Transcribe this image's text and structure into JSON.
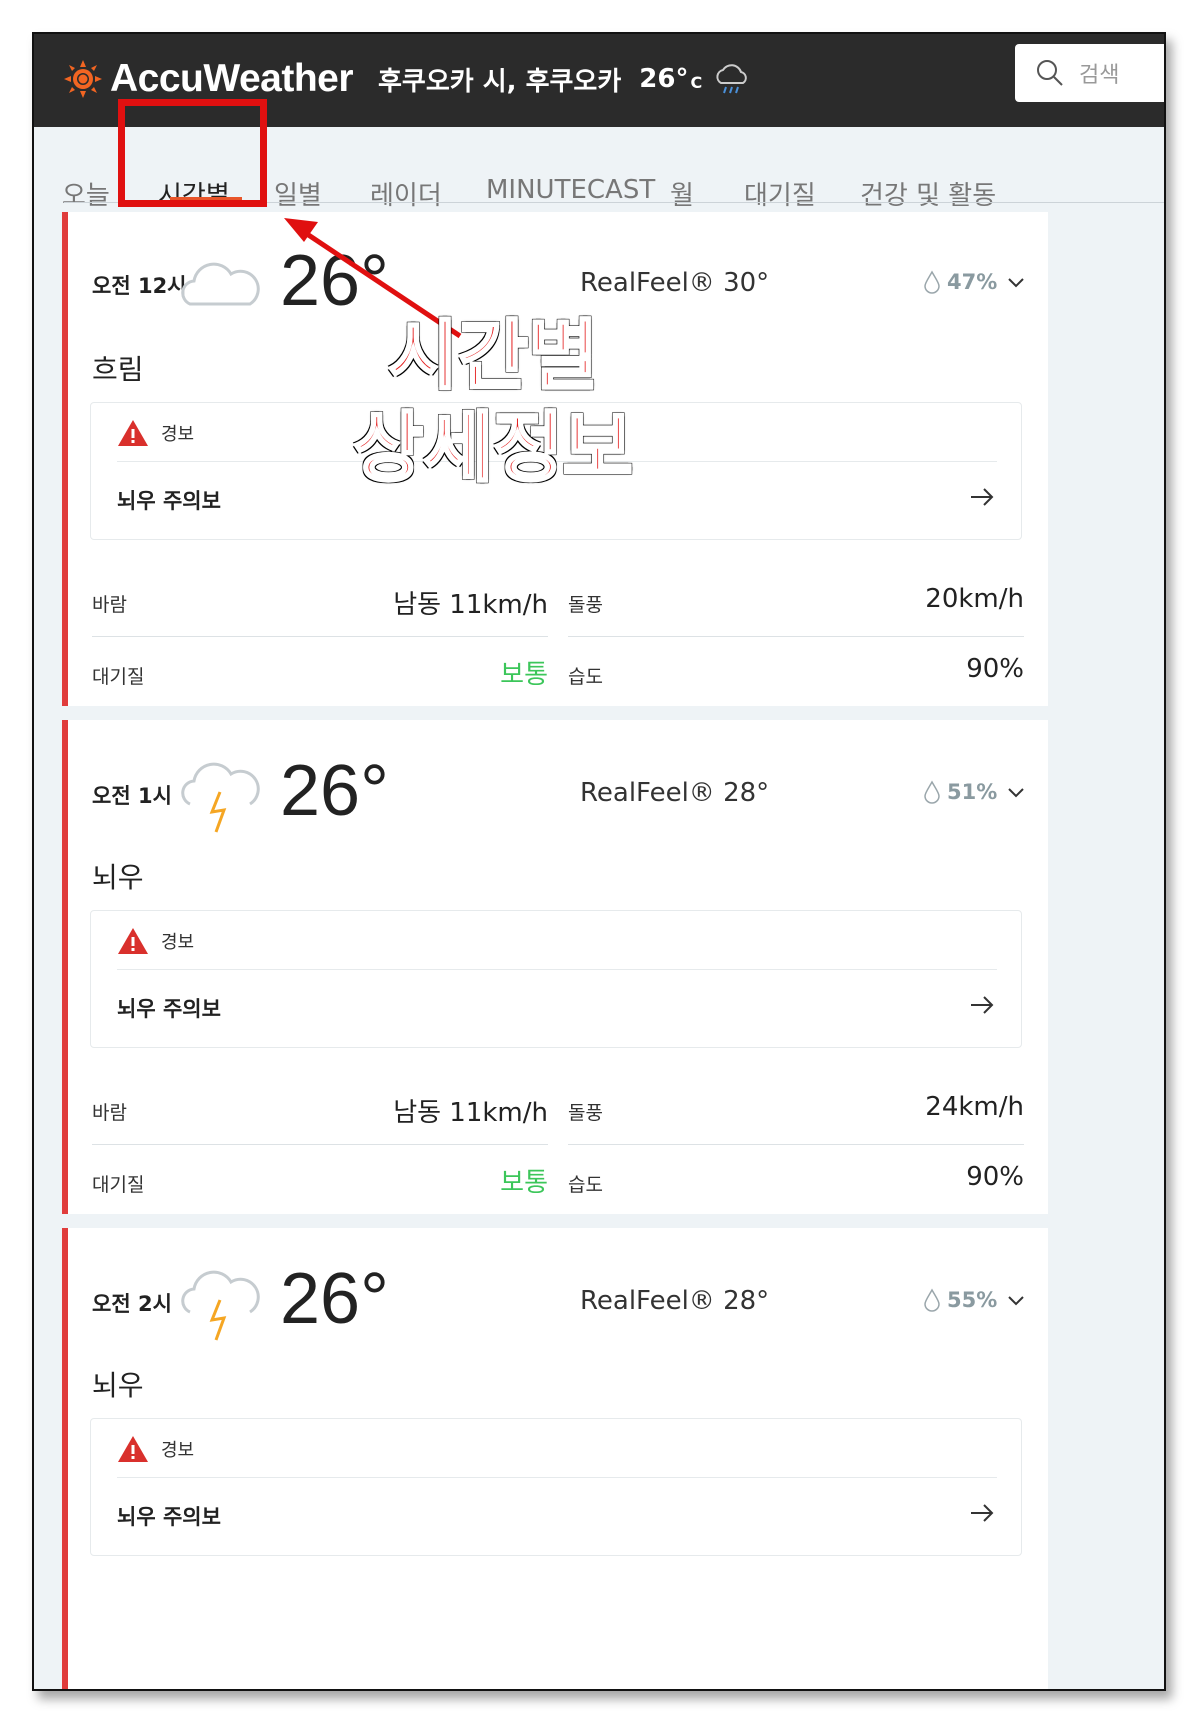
{
  "header": {
    "brand": "AccuWeather",
    "location": "후쿠오카 시, 후쿠오카",
    "current_temp": "26°",
    "unit": "C",
    "search_placeholder": "검색"
  },
  "nav": {
    "tabs": [
      "오늘",
      "시간별",
      "일별",
      "레이더",
      "MINUTECAST",
      "월",
      "대기질",
      "건강 및 활동"
    ],
    "active_index": 1
  },
  "annotation": {
    "line1": "시간별",
    "line2": "상세정보"
  },
  "hours": [
    {
      "time": "오전 12시",
      "temp": "26°",
      "realfeel_label": "RealFeel®",
      "realfeel": "30°",
      "precip": "47%",
      "condition": "흐림",
      "icon": "cloud-icon",
      "alert_title": "경보",
      "alert_name": "뇌우 주의보",
      "wind_label": "바람",
      "wind": "남동 11km/h",
      "gust_label": "돌풍",
      "gust": "20km/h",
      "air_label": "대기질",
      "air": "보통",
      "humidity_label": "습도",
      "humidity": "90%"
    },
    {
      "time": "오전 1시",
      "temp": "26°",
      "realfeel_label": "RealFeel®",
      "realfeel": "28°",
      "precip": "51%",
      "condition": "뇌우",
      "icon": "thunderstorm-icon",
      "alert_title": "경보",
      "alert_name": "뇌우 주의보",
      "wind_label": "바람",
      "wind": "남동 11km/h",
      "gust_label": "돌풍",
      "gust": "24km/h",
      "air_label": "대기질",
      "air": "보통",
      "humidity_label": "습도",
      "humidity": "90%"
    },
    {
      "time": "오전 2시",
      "temp": "26°",
      "realfeel_label": "RealFeel®",
      "realfeel": "28°",
      "precip": "55%",
      "condition": "뇌우",
      "icon": "thunderstorm-icon",
      "alert_title": "경보",
      "alert_name": "뇌우 주의보"
    }
  ],
  "colors": {
    "accent": "#e8552a",
    "alert_border": "#e03c3c",
    "good_air": "#3cc65a",
    "annotation": "#e41c1c"
  }
}
